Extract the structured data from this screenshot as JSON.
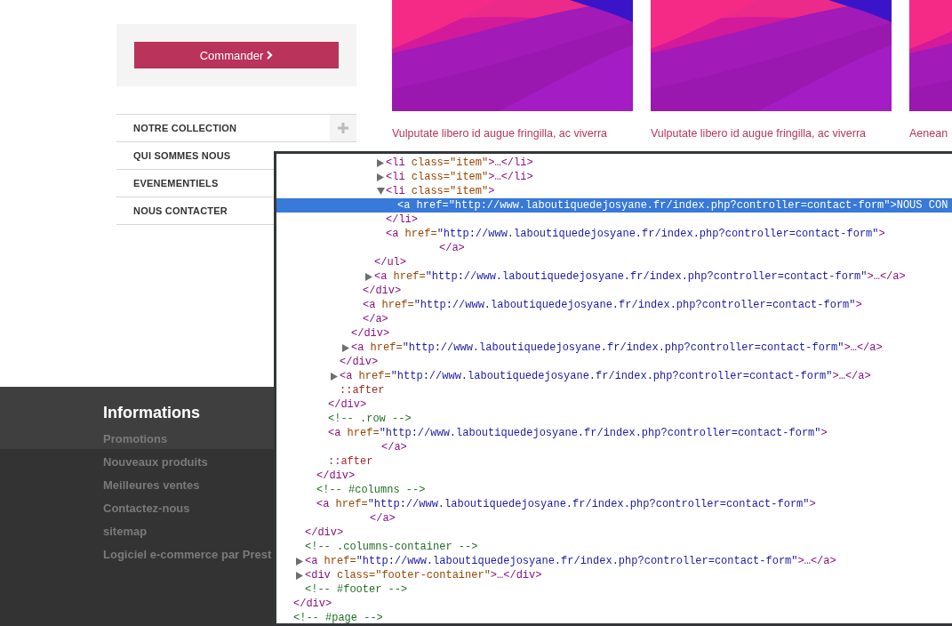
{
  "sidebar": {
    "order_button": {
      "label": "Commander"
    },
    "menu": [
      {
        "label": "NOTRE COLLECTION",
        "expanded": false
      },
      {
        "label": "QUI SOMMES NOUS"
      },
      {
        "label": "EVENEMENTIELS"
      },
      {
        "label": "NOUS CONTACTER"
      }
    ]
  },
  "products": [
    {
      "lines": [
        "Vulputate libero id augue fringilla, ac viverra"
      ]
    },
    {
      "lines": [
        "Vulputate libero id augue fringilla, ac viverra"
      ]
    },
    {
      "lines": [
        "Aenean"
      ]
    }
  ],
  "footer": {
    "title": "Informations",
    "links": [
      "Promotions",
      "Nouveaux produits",
      "Meilleures ventes",
      "Contactez-nous",
      "sitemap",
      "Logiciel e-commerce par Prest"
    ]
  },
  "devtools": {
    "lines": [
      {
        "kind": "group",
        "children": [
          {
            "kind": "group",
            "children": [
              {
                "kind": "group",
                "children": [
                  {
                    "kind": "group",
                    "children": [
                      {
                        "kind": "group",
                        "children": [
                          {
                            "kind": "group",
                            "children": [
                              {
                                "kind": "group",
                                "children": [
                                  {
                                    "kind": "group",
                                    "children": [
                                      {
                                        "kind": "node",
                                        "selected": false,
                                        "expanded": false,
                                        "tokens": [
                                          {
                                            "kind": "tag",
                                            "text": "<li"
                                          },
                                          {
                                            "kind": "attr",
                                            "text": " class=\"item\""
                                          },
                                          {
                                            "kind": "tag",
                                            "text": ">…</li>"
                                          }
                                        ]
                                      },
                                      {
                                        "kind": "node",
                                        "selected": false,
                                        "expanded": false,
                                        "tokens": [
                                          {
                                            "kind": "tag",
                                            "text": "<li"
                                          },
                                          {
                                            "kind": "attr",
                                            "text": " class=\"item\""
                                          },
                                          {
                                            "kind": "tag",
                                            "text": ">…</li>"
                                          }
                                        ]
                                      },
                                      {
                                        "kind": "node",
                                        "selected": false,
                                        "expanded": true,
                                        "tokens": [
                                          {
                                            "kind": "tag",
                                            "text": "<li"
                                          },
                                          {
                                            "kind": "attr",
                                            "text": " class=\"item\""
                                          },
                                          {
                                            "kind": "tag",
                                            "text": ">"
                                          }
                                        ],
                                        "children": [
                                          {
                                            "kind": "node",
                                            "selected": true,
                                            "tokens": [
                                              {
                                                "kind": "tag",
                                                "text": "<a"
                                              },
                                              {
                                                "kind": "attr",
                                                "text": " href="
                                              },
                                              {
                                                "kind": "value",
                                                "text": "\"http://www.laboutiquedejosyane.fr/index.php?controller=contact-form\""
                                              },
                                              {
                                                "kind": "tag",
                                                "text": ">"
                                              },
                                              {
                                                "kind": "text",
                                                "text": "NOUS CON"
                                              }
                                            ]
                                          }
                                        ]
                                      },
                                      {
                                        "kind": "node",
                                        "selected": false,
                                        "tokens": [
                                          {
                                            "kind": "tag",
                                            "text": "</li>"
                                          }
                                        ]
                                      },
                                      {
                                        "kind": "node",
                                        "selected": false,
                                        "tokens": [
                                          {
                                            "kind": "tag",
                                            "text": "<a"
                                          },
                                          {
                                            "kind": "attr",
                                            "text": " href="
                                          },
                                          {
                                            "kind": "value",
                                            "text": "\"http://www.laboutiquedejosyane.fr/index.php?controller=contact-form\""
                                          },
                                          {
                                            "kind": "tag",
                                            "text": ">"
                                          }
                                        ],
                                        "children": [
                                          {
                                            "kind": "wrapped",
                                            "selected": false,
                                            "tokens": [
                                              {
                                                "kind": "tag",
                                                "text": "</a>"
                                              }
                                            ]
                                          }
                                        ]
                                      }
                                    ]
                                  },
                                  {
                                    "kind": "node",
                                    "selected": false,
                                    "tokens": [
                                      {
                                        "kind": "tag",
                                        "text": "</ul>"
                                      }
                                    ]
                                  },
                                  {
                                    "kind": "node",
                                    "selected": false,
                                    "expanded": false,
                                    "tokens": [
                                      {
                                        "kind": "tag",
                                        "text": "<a"
                                      },
                                      {
                                        "kind": "attr",
                                        "text": " href="
                                      },
                                      {
                                        "kind": "value",
                                        "text": "\"http://www.laboutiquedejosyane.fr/index.php?controller=contact-form\""
                                      },
                                      {
                                        "kind": "tag",
                                        "text": ">…</a>"
                                      }
                                    ]
                                  }
                                ]
                              },
                              {
                                "kind": "node",
                                "selected": false,
                                "tokens": [
                                  {
                                    "kind": "tag",
                                    "text": "</div>"
                                  }
                                ]
                              },
                              {
                                "kind": "node",
                                "selected": false,
                                "tokens": [
                                  {
                                    "kind": "tag",
                                    "text": "<a"
                                  },
                                  {
                                    "kind": "attr",
                                    "text": " href="
                                  },
                                  {
                                    "kind": "value",
                                    "text": "\"http://www.laboutiquedejosyane.fr/index.php?controller=contact-form\""
                                  },
                                  {
                                    "kind": "tag",
                                    "text": ">"
                                  }
                                ]
                              },
                              {
                                "kind": "node",
                                "selected": false,
                                "tokens": [
                                  {
                                    "kind": "tag",
                                    "text": "</a>"
                                  }
                                ]
                              }
                            ]
                          },
                          {
                            "kind": "node",
                            "selected": false,
                            "tokens": [
                              {
                                "kind": "tag",
                                "text": "</div>"
                              }
                            ]
                          },
                          {
                            "kind": "node",
                            "selected": false,
                            "expanded": false,
                            "tokens": [
                              {
                                "kind": "tag",
                                "text": "<a"
                              },
                              {
                                "kind": "attr",
                                "text": " href="
                              },
                              {
                                "kind": "value",
                                "text": "\"http://www.laboutiquedejosyane.fr/index.php?controller=contact-form\""
                              },
                              {
                                "kind": "tag",
                                "text": ">…</a>"
                              }
                            ]
                          }
                        ]
                      },
                      {
                        "kind": "node",
                        "selected": false,
                        "tokens": [
                          {
                            "kind": "tag",
                            "text": "</div>"
                          }
                        ]
                      },
                      {
                        "kind": "node",
                        "selected": false,
                        "expanded": false,
                        "tokens": [
                          {
                            "kind": "tag",
                            "text": "<a"
                          },
                          {
                            "kind": "attr",
                            "text": " href="
                          },
                          {
                            "kind": "value",
                            "text": "\"http://www.laboutiquedejosyane.fr/index.php?controller=contact-form\""
                          },
                          {
                            "kind": "tag",
                            "text": ">…</a>"
                          }
                        ]
                      },
                      {
                        "kind": "node",
                        "selected": false,
                        "tokens": [
                          {
                            "kind": "pseudo",
                            "text": "::after"
                          }
                        ]
                      }
                    ]
                  },
                  {
                    "kind": "node",
                    "selected": false,
                    "tokens": [
                      {
                        "kind": "tag",
                        "text": "</div>"
                      }
                    ]
                  },
                  {
                    "kind": "node",
                    "selected": false,
                    "tokens": [
                      {
                        "kind": "comment",
                        "text": "<!-- .row -->"
                      }
                    ]
                  },
                  {
                    "kind": "node",
                    "selected": false,
                    "tokens": [
                      {
                        "kind": "tag",
                        "text": "<a"
                      },
                      {
                        "kind": "attr",
                        "text": " href="
                      },
                      {
                        "kind": "value",
                        "text": "\"http://www.laboutiquedejosyane.fr/index.php?controller=contact-form\""
                      },
                      {
                        "kind": "tag",
                        "text": ">"
                      }
                    ],
                    "children": [
                      {
                        "kind": "wrapped",
                        "selected": false,
                        "tokens": [
                          {
                            "kind": "tag",
                            "text": "</a>"
                          }
                        ]
                      }
                    ]
                  },
                  {
                    "kind": "node",
                    "selected": false,
                    "tokens": [
                      {
                        "kind": "pseudo",
                        "text": "::after"
                      }
                    ]
                  }
                ]
              },
              {
                "kind": "node",
                "selected": false,
                "tokens": [
                  {
                    "kind": "tag",
                    "text": "</div>"
                  }
                ]
              },
              {
                "kind": "node",
                "selected": false,
                "tokens": [
                  {
                    "kind": "comment",
                    "text": "<!-- #columns -->"
                  }
                ]
              },
              {
                "kind": "node",
                "selected": false,
                "tokens": [
                  {
                    "kind": "tag",
                    "text": "<a"
                  },
                  {
                    "kind": "attr",
                    "text": " href="
                  },
                  {
                    "kind": "value",
                    "text": "\"http://www.laboutiquedejosyane.fr/index.php?controller=contact-form\""
                  },
                  {
                    "kind": "tag",
                    "text": ">"
                  }
                ],
                "children": [
                  {
                    "kind": "wrapped",
                    "selected": false,
                    "tokens": [
                      {
                        "kind": "tag",
                        "text": "</a>"
                      }
                    ]
                  }
                ]
              }
            ]
          },
          {
            "kind": "node",
            "selected": false,
            "tokens": [
              {
                "kind": "tag",
                "text": "</div>"
              }
            ]
          },
          {
            "kind": "node",
            "selected": false,
            "tokens": [
              {
                "kind": "comment",
                "text": "<!-- .columns-container -->"
              }
            ]
          },
          {
            "kind": "node",
            "selected": false,
            "expanded": false,
            "tokens": [
              {
                "kind": "tag",
                "text": "<a"
              },
              {
                "kind": "attr",
                "text": " href="
              },
              {
                "kind": "value",
                "text": "\"http://www.laboutiquedejosyane.fr/index.php?controller=contact-form\""
              },
              {
                "kind": "tag",
                "text": ">…</a>"
              }
            ]
          },
          {
            "kind": "node",
            "selected": false,
            "expanded": false,
            "tokens": [
              {
                "kind": "tag",
                "text": "<div"
              },
              {
                "kind": "attr",
                "text": " class=\"footer-container\""
              },
              {
                "kind": "tag",
                "text": ">…</div>"
              }
            ]
          },
          {
            "kind": "node",
            "selected": false,
            "tokens": [
              {
                "kind": "comment",
                "text": "<!-- #footer -->"
              }
            ]
          }
        ]
      },
      {
        "kind": "node",
        "selected": false,
        "tokens": [
          {
            "kind": "tag",
            "text": "</div>"
          }
        ]
      },
      {
        "kind": "node",
        "selected": false,
        "tokens": [
          {
            "kind": "comment",
            "text": "<!-- #page -->"
          }
        ]
      }
    ]
  }
}
